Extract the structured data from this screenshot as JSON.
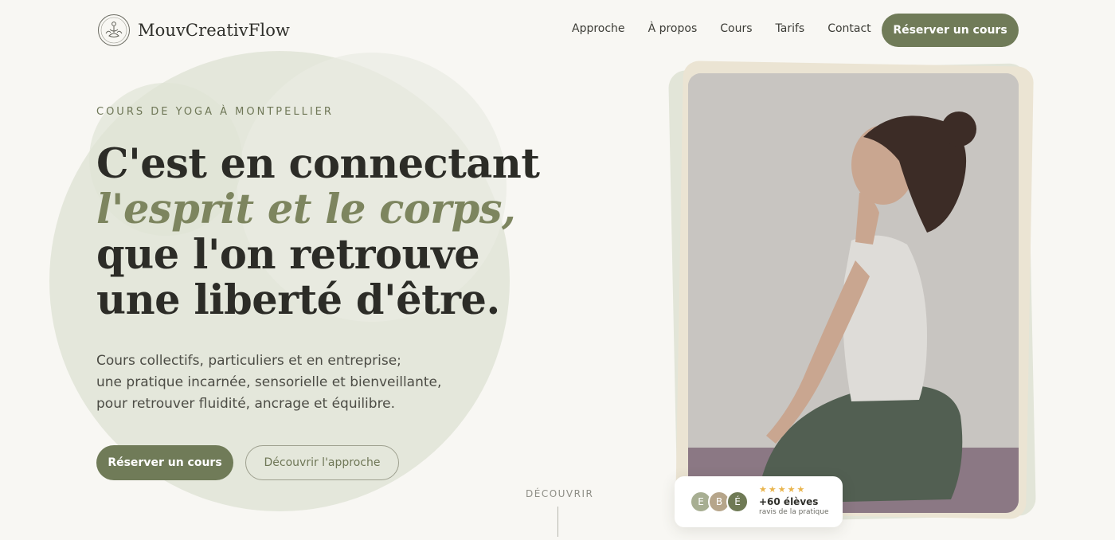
{
  "brand": {
    "name": "MouvCreativFlow",
    "logo_icon": "lotus-icon"
  },
  "nav": {
    "links": [
      "Approche",
      "À propos",
      "Cours",
      "Tarifs",
      "Contact"
    ],
    "cta_label": "Réserver un cours"
  },
  "hero": {
    "kicker": "COURS DE YOGA À MONTPELLIER",
    "headline_line1": "C'est en connectant",
    "headline_line2": "l'esprit et le corps,",
    "headline_line3": "que l'on retrouve",
    "headline_line4": "une liberté d'être.",
    "subtitle_line1": "Cours collectifs, particuliers et en entreprise;",
    "subtitle_line2": "une pratique incarnée, sensorielle et bienveillante,",
    "subtitle_line3": "pour retrouver fluidité, ancrage et équilibre.",
    "primary_button": "Réserver un cours",
    "secondary_button": "Découvrir l'approche"
  },
  "scroll_hint": {
    "label": "DÉCOUVRIR"
  },
  "review_card": {
    "avatars": [
      {
        "initial": "E",
        "color": "#a7ae92"
      },
      {
        "initial": "B",
        "color": "#b6a58a"
      },
      {
        "initial": "É",
        "color": "#6f7a55"
      }
    ],
    "rating": 5,
    "count": "+60 élèves",
    "caption": "ravis de la pratique"
  },
  "colors": {
    "accent": "#707b58",
    "background": "#f8f7f3",
    "star": "#e9b44c"
  }
}
